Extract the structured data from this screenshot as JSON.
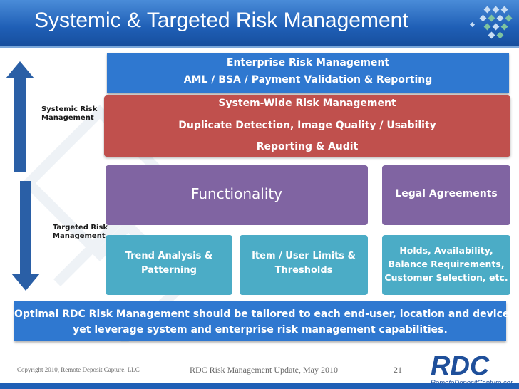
{
  "slide": {
    "title": "Systemic & Targeted Risk Management"
  },
  "boxes": {
    "enterprise": {
      "heading": "Enterprise Risk Management",
      "line1": "AML / BSA / Payment Validation & Reporting"
    },
    "system_wide": {
      "heading": "System-Wide Risk Management",
      "line1": "Duplicate Detection, Image Quality / Usability",
      "line2": "Reporting & Audit"
    },
    "functionality": "Functionality",
    "legal": "Legal Agreements",
    "trend": {
      "line1": "Trend Analysis &",
      "line2": "Patterning"
    },
    "limits": {
      "line1": "Item / User Limits &",
      "line2": "Thresholds"
    },
    "holds": {
      "line1": "Holds, Availability,",
      "line2": "Balance Requirements,",
      "line3": "Customer Selection, etc."
    }
  },
  "side_labels": {
    "systemic": {
      "line1": "Systemic Risk",
      "line2": "Management"
    },
    "targeted": {
      "line1": "Targeted Risk",
      "line2": "Management"
    }
  },
  "bottom": {
    "line1": "Optimal RDC Risk Management should be tailored to each end-user, location and device,",
    "line2": "yet leverage system and enterprise risk management capabilities."
  },
  "footer": {
    "copyright": "Copyright 2010, Remote Deposit Capture, LLC",
    "center": "RDC Risk Management Update, May 2010",
    "page": "21"
  },
  "logo": {
    "mark": "RDC",
    "site": "RemoteDepositCapture.com"
  },
  "colors": {
    "header_blue": "#1f5fb6",
    "enterprise_blue": "#2f78d0",
    "system_red": "#c0504d",
    "purple": "#8064a2",
    "teal": "#4bacc6",
    "arrow_blue": "#2a5fa6"
  }
}
